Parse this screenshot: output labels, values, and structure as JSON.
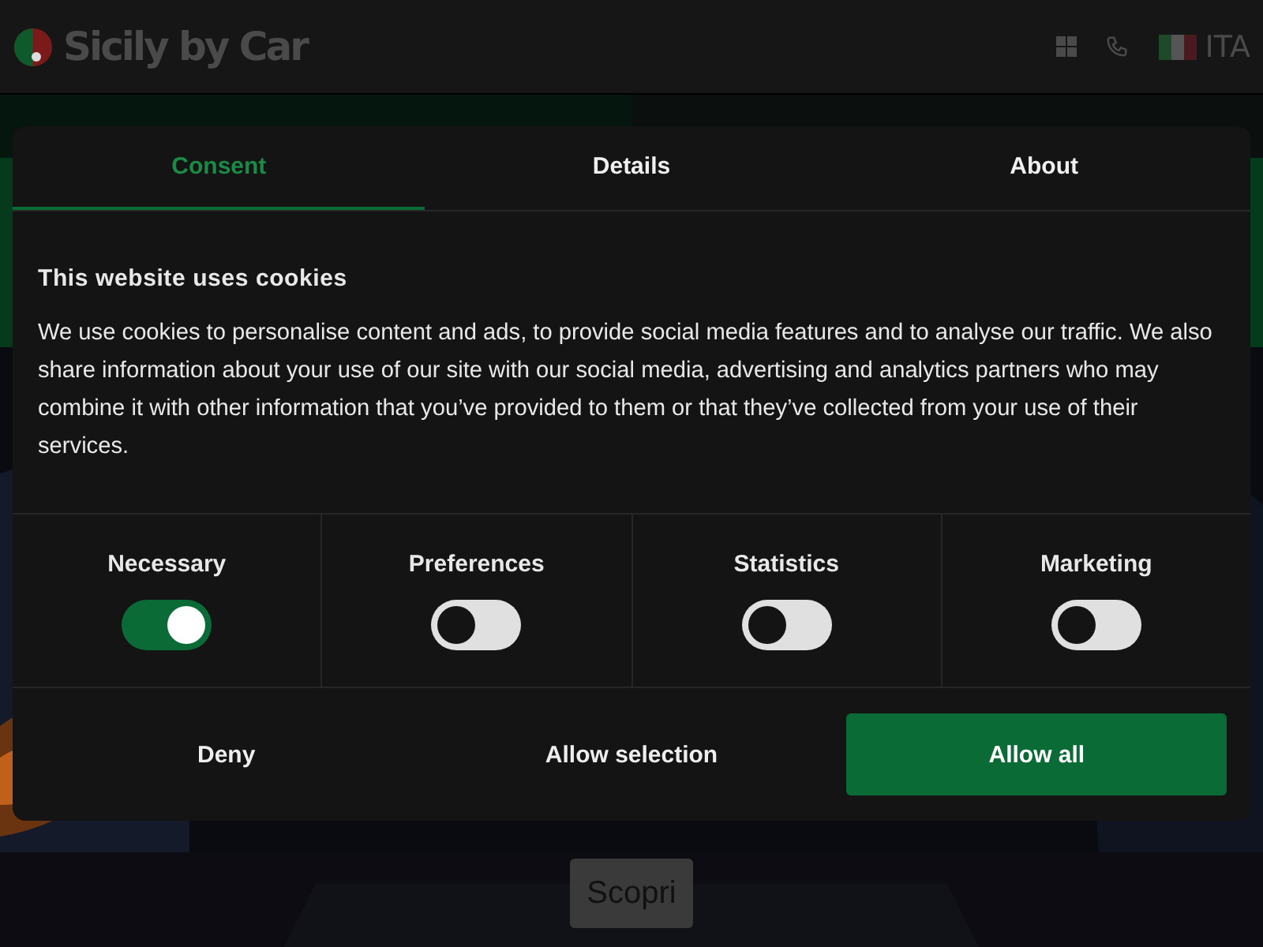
{
  "header": {
    "logo": "Sicily by Car",
    "language": "ITA"
  },
  "hero": {
    "button": "Scopri"
  },
  "consent_dialog": {
    "tabs": [
      {
        "label": "Consent",
        "selected": true
      },
      {
        "label": "Details",
        "selected": false
      },
      {
        "label": "About",
        "selected": false
      }
    ],
    "heading": "This website uses cookies",
    "text": "We use cookies to personalise content and ads, to provide social media features and to analyse our traffic. We also share information about your use of our site with our social media, advertising and analytics partners who may combine it with other information that you’ve provided to them or that they’ve collected from your use of their services.",
    "categories": [
      {
        "label": "Necessary",
        "on": true
      },
      {
        "label": "Preferences",
        "on": false
      },
      {
        "label": "Statistics",
        "on": false
      },
      {
        "label": "Marketing",
        "on": false
      }
    ],
    "buttons": [
      {
        "label": "Deny",
        "kind": "plain"
      },
      {
        "label": "Allow selection",
        "kind": "plain"
      },
      {
        "label": "Allow all",
        "kind": "primary"
      }
    ]
  }
}
